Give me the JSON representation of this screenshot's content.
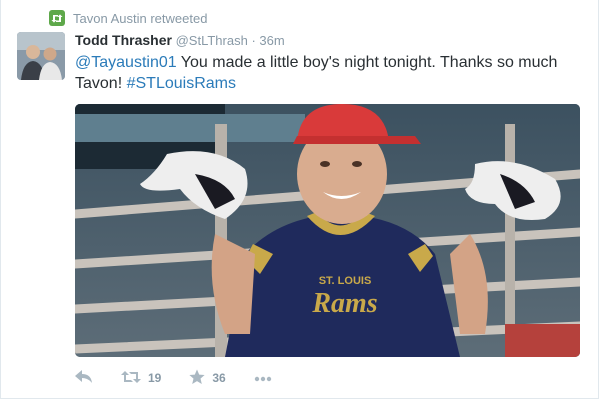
{
  "retweet_context": {
    "text": "Tavon Austin retweeted",
    "icon": "retweet-icon"
  },
  "author": {
    "fullname": "Todd Thrasher",
    "username": "@StLThrash",
    "separator": "·",
    "time": "36m"
  },
  "tweet": {
    "mention": "@Tayaustin01",
    "body": "You made a little boy's night tonight.  Thanks so much Tavon!",
    "hashtag": "#STLouisRams"
  },
  "photo": {
    "jersey_text": "ST. LOUIS",
    "jersey_logo": "Rams"
  },
  "actions": {
    "reply_icon": "reply-icon",
    "retweet_icon": "retweet-icon",
    "retweet_count": "19",
    "favorite_icon": "star-icon",
    "favorite_count": "36",
    "more_icon": "more-icon"
  },
  "colors": {
    "link": "#2b7bb9",
    "retweet_badge": "#5ea84a",
    "muted": "#8899a6",
    "action_icon": "#aab8c2",
    "text": "#292f33"
  }
}
